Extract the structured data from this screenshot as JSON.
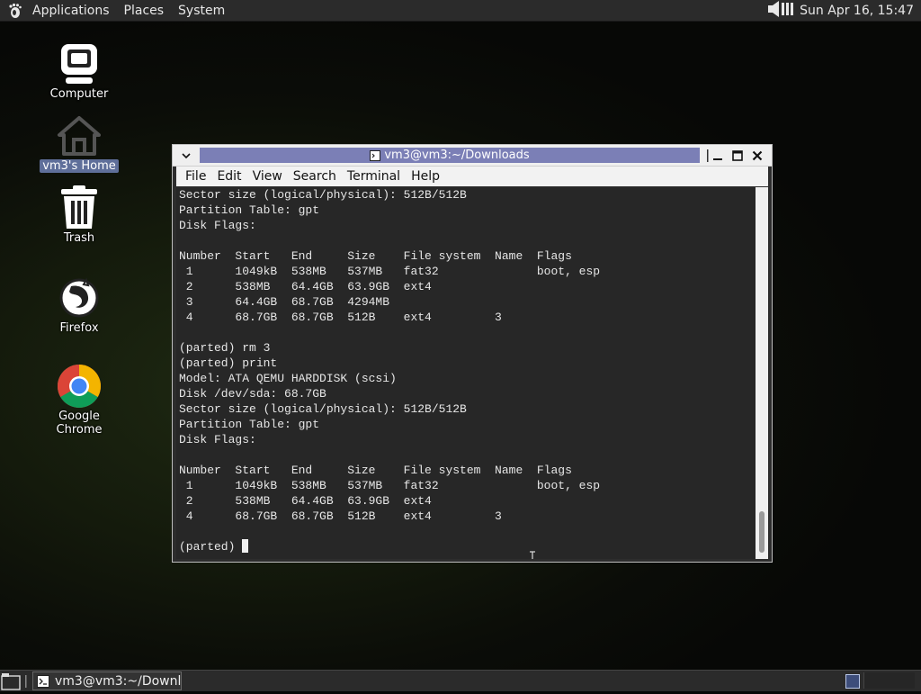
{
  "top_panel": {
    "menus": [
      "Applications",
      "Places",
      "System"
    ],
    "clock": "Sun Apr 16, 15:47"
  },
  "desktop": {
    "icons": [
      {
        "label": "Computer",
        "icon": "computer-icon"
      },
      {
        "label": "vm3's Home",
        "icon": "home-icon"
      },
      {
        "label": "Trash",
        "icon": "trash-icon"
      },
      {
        "label": "Firefox",
        "icon": "firefox-icon"
      },
      {
        "label": "Google Chrome",
        "icon": "chrome-icon"
      }
    ]
  },
  "terminal": {
    "title": "vm3@vm3:~/Downloads",
    "menus": [
      "File",
      "Edit",
      "View",
      "Search",
      "Terminal",
      "Help"
    ],
    "lines": [
      "Sector size (logical/physical): 512B/512B",
      "Partition Table: gpt",
      "Disk Flags:",
      "",
      "Number  Start   End     Size    File system  Name  Flags",
      " 1      1049kB  538MB   537MB   fat32              boot, esp",
      " 2      538MB   64.4GB  63.9GB  ext4",
      " 3      64.4GB  68.7GB  4294MB",
      " 4      68.7GB  68.7GB  512B    ext4         3",
      "",
      "(parted) rm 3",
      "(parted) print",
      "Model: ATA QEMU HARDDISK (scsi)",
      "Disk /dev/sda: 68.7GB",
      "Sector size (logical/physical): 512B/512B",
      "Partition Table: gpt",
      "Disk Flags:",
      "",
      "Number  Start   End     Size    File system  Name  Flags",
      " 1      1049kB  538MB   537MB   fat32              boot, esp",
      " 2      538MB   64.4GB  63.9GB  ext4",
      " 4      68.7GB  68.7GB  512B    ext4         3",
      ""
    ],
    "prompt": "(parted) "
  },
  "bottom_panel": {
    "task": "vm3@vm3:~/Downl..."
  },
  "colors": {
    "title_tab": "#7b7fb6",
    "terminal_bg": "#272727",
    "panel_bg": "#2b2b2b"
  }
}
